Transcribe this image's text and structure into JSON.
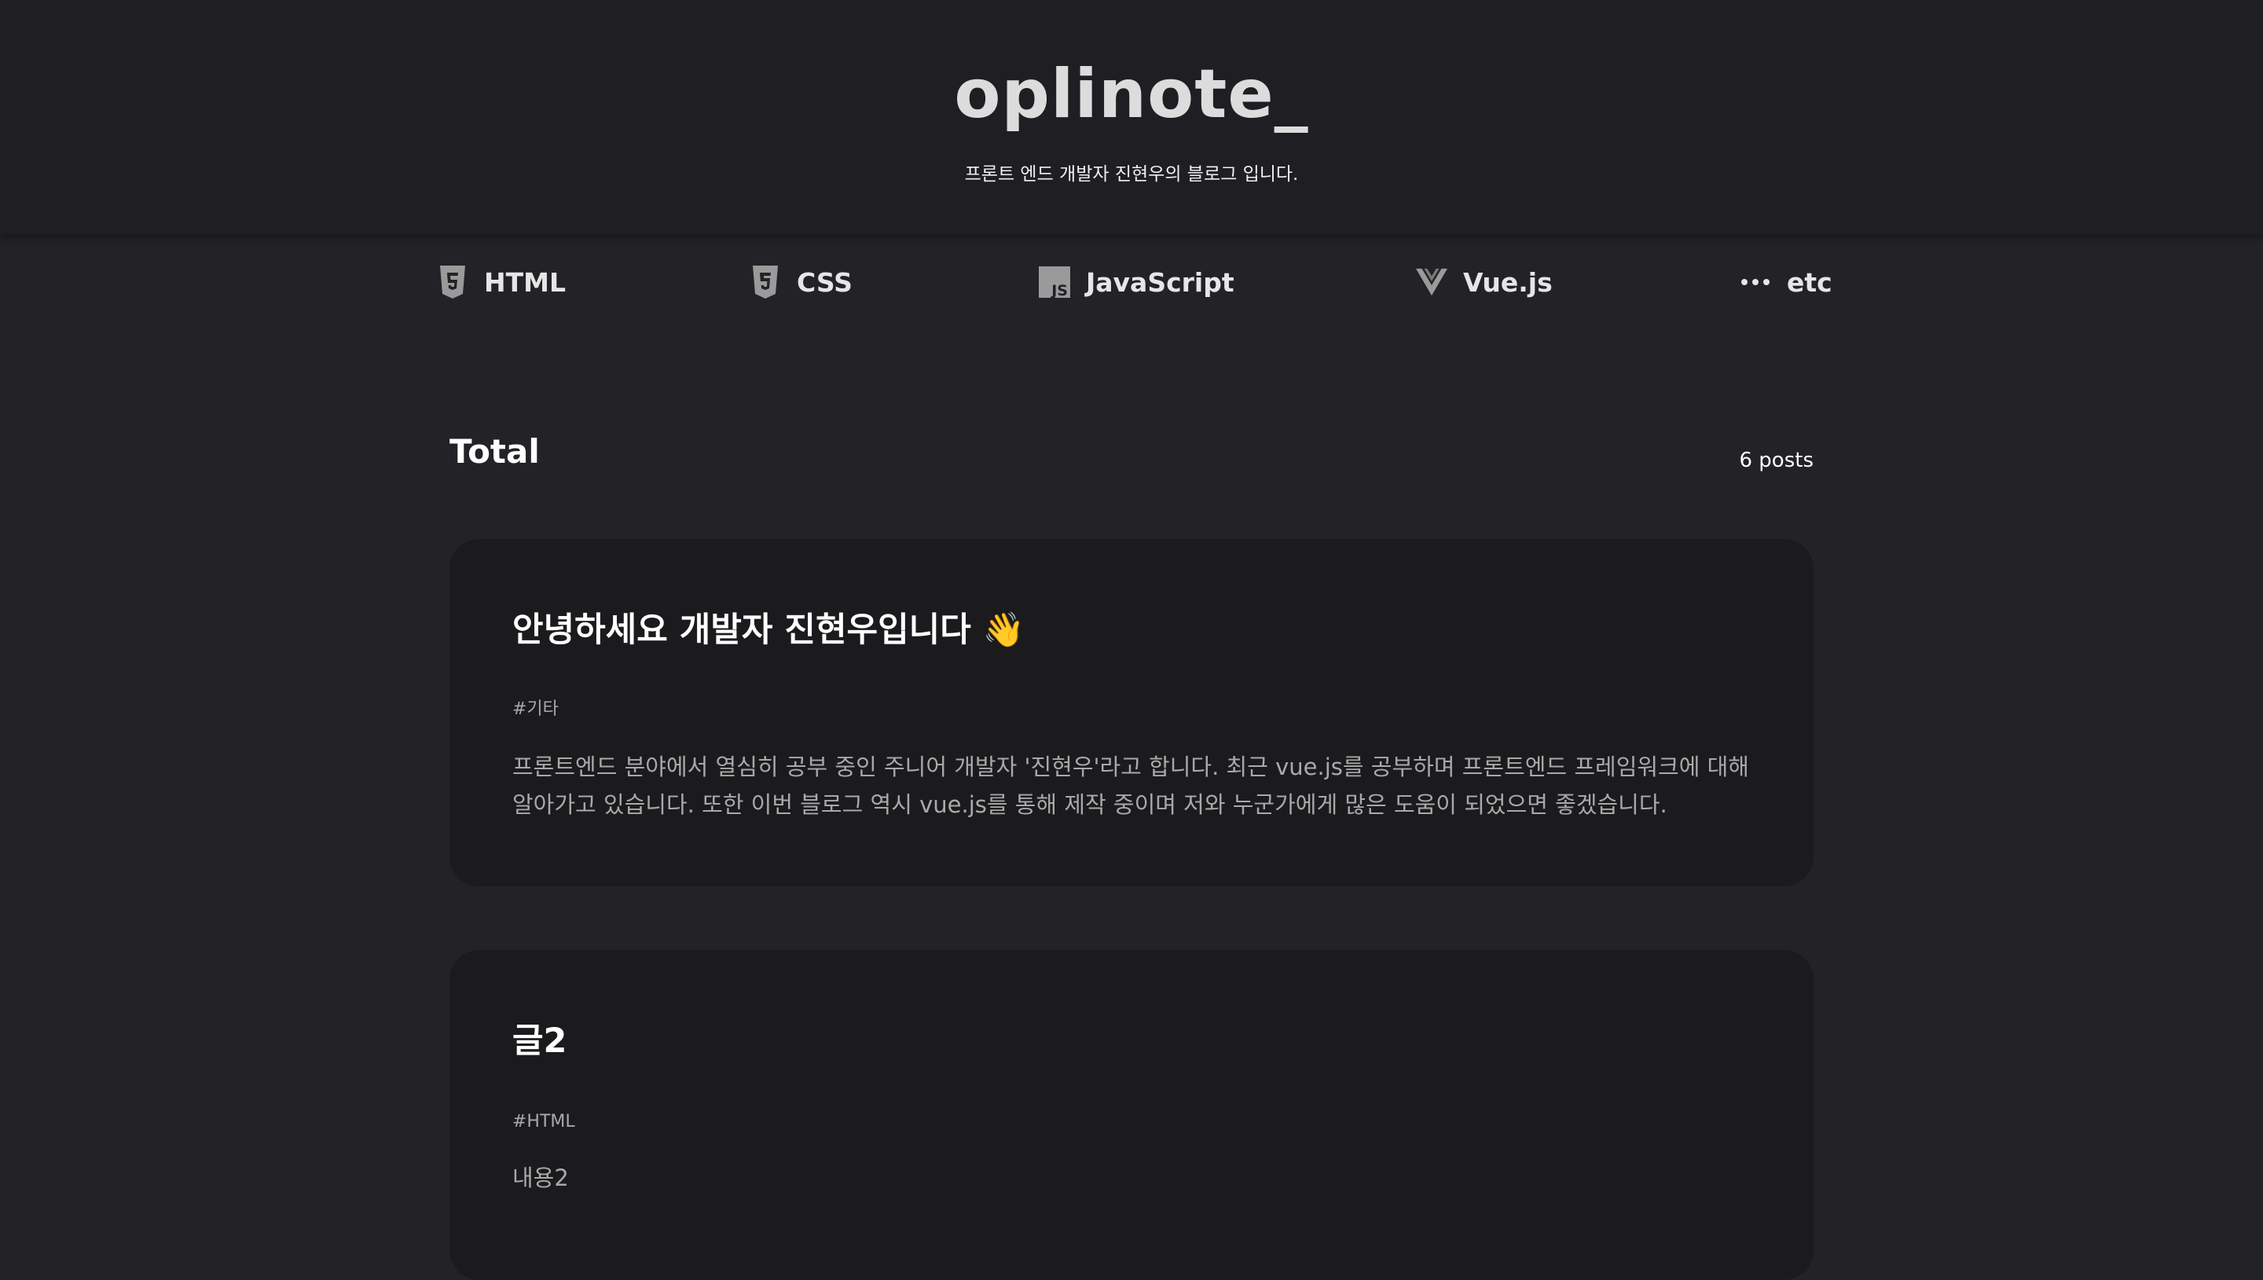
{
  "header": {
    "title": "oplinote_",
    "description": "프론트 엔드 개발자 진현우의 블로그 입니다."
  },
  "nav": {
    "items": [
      {
        "label": "HTML",
        "icon": "html5-icon"
      },
      {
        "label": "CSS",
        "icon": "css3-icon"
      },
      {
        "label": "JavaScript",
        "icon": "javascript-icon"
      },
      {
        "label": "Vue.js",
        "icon": "vuejs-icon"
      },
      {
        "label": "etc",
        "icon": "ellipsis-icon"
      }
    ]
  },
  "section": {
    "title": "Total",
    "count": "6 posts"
  },
  "posts": [
    {
      "title": "안녕하세요 개발자 진현우입니다 👋",
      "tag": "#기타",
      "body": "프론트엔드 분야에서 열심히 공부 중인 주니어 개발자 '진현우'라고 합니다. 최근 vue.js를 공부하며 프론트엔드 프레임워크에 대해 알아가고 있습니다. 또한 이번 블로그 역시 vue.js를 통해 제작 중이며 저와 누군가에게 많은 도움이 되었으면 좋겠습니다."
    },
    {
      "title": "글2",
      "tag": "#HTML",
      "body": "내용2"
    }
  ],
  "colors": {
    "background": "#222227",
    "header": "#1e1e23",
    "card": "#1b1b1e",
    "text": "#ffffff",
    "muted": "#a9a9a9"
  }
}
